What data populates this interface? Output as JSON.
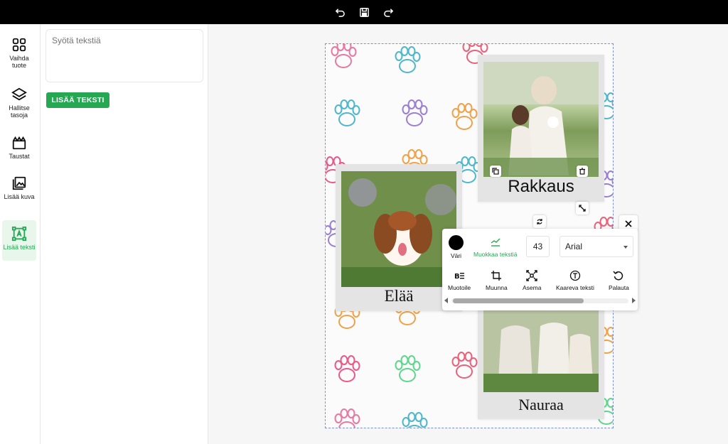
{
  "topbar": {
    "undo_icon": "undo-icon",
    "save_icon": "save-icon",
    "redo_icon": "redo-icon"
  },
  "sidebar": {
    "items": [
      {
        "label": "Vaihda tuote",
        "icon": "grid-icon"
      },
      {
        "label": "Hallitse tasoja",
        "icon": "layers-icon"
      },
      {
        "label": "Taustat",
        "icon": "backgrounds-icon"
      },
      {
        "label": "Lisää kuva",
        "icon": "image-icon"
      },
      {
        "label": "Lisää teksti",
        "icon": "text-icon",
        "active": true
      }
    ]
  },
  "text_panel": {
    "placeholder": "Syötä tekstiä",
    "add_button": "LISÄÄ TEKSTI"
  },
  "canvas": {
    "photos": [
      {
        "caption": "Rakkaus"
      },
      {
        "caption": "Elää"
      },
      {
        "caption": "Nauraa"
      }
    ]
  },
  "toolbar": {
    "color_label": "Väri",
    "edit_label": "Muokkaa tekstiä",
    "font_size": "43",
    "font_name": "Arial",
    "tools": [
      {
        "label": "Muotoile",
        "icon": "format-icon"
      },
      {
        "label": "Muunna",
        "icon": "transform-icon"
      },
      {
        "label": "Asema",
        "icon": "position-icon"
      },
      {
        "label": "Kaareva teksti",
        "icon": "curved-text-icon"
      },
      {
        "label": "Palauta",
        "icon": "reset-icon"
      }
    ],
    "scroll_position": 0.0
  },
  "colors": {
    "accent": "#26a852",
    "topbar": "#000000",
    "selected_text_color": "#000000"
  }
}
